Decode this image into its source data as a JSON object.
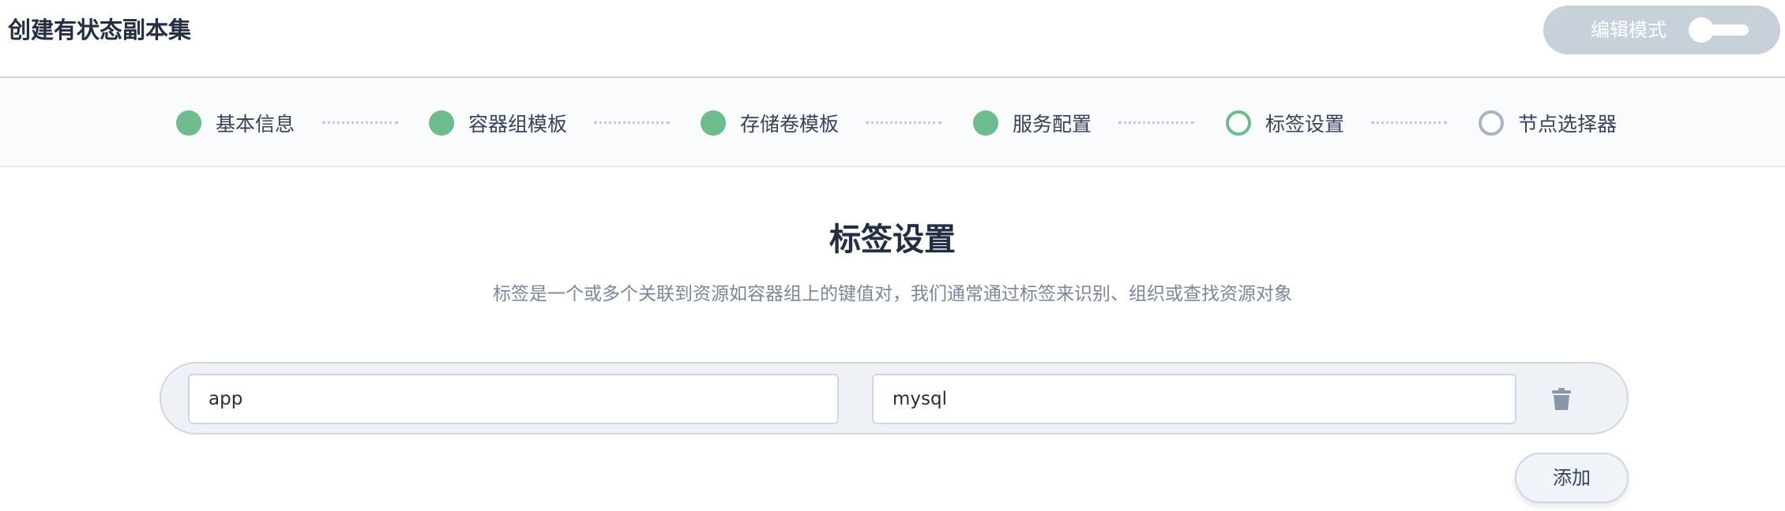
{
  "header": {
    "title": "创建有状态副本集",
    "edit_mode_label": "编辑模式",
    "edit_mode_on": false
  },
  "steps": [
    {
      "label": "基本信息",
      "state": "done"
    },
    {
      "label": "容器组模板",
      "state": "done"
    },
    {
      "label": "存储卷模板",
      "state": "done"
    },
    {
      "label": "服务配置",
      "state": "done"
    },
    {
      "label": "标签设置",
      "state": "active"
    },
    {
      "label": "节点选择器",
      "state": "todo"
    }
  ],
  "main": {
    "heading": "标签设置",
    "description": "标签是一个或多个关联到资源如容器组上的键值对，我们通常通过标签来识别、组织或查找资源对象",
    "labels": [
      {
        "key": "app",
        "value": "mysql"
      }
    ],
    "add_label": "添加"
  },
  "icons": {
    "delete": "trash-icon"
  },
  "colors": {
    "done": "#6dbd8c",
    "todo": "#abb4c2",
    "toggle_bg": "#c8d0da"
  }
}
